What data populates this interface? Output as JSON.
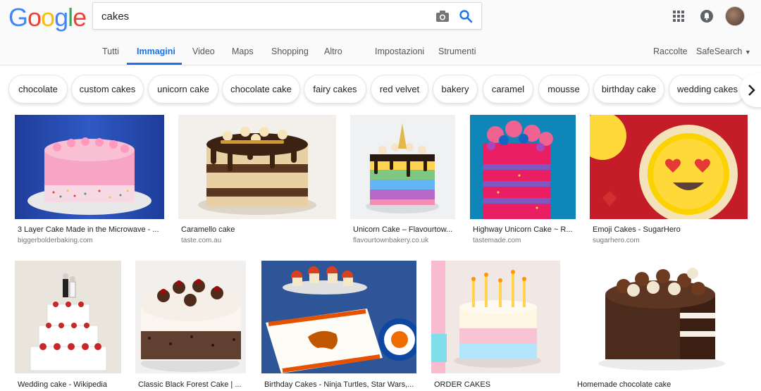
{
  "logo": {
    "letters": [
      "G",
      "o",
      "o",
      "g",
      "l",
      "e"
    ],
    "colors": [
      "#4285f4",
      "#ea4335",
      "#fbbc05",
      "#4285f4",
      "#34a853",
      "#ea4335"
    ]
  },
  "search": {
    "value": "cakes"
  },
  "nav": {
    "tabs": [
      "Tutti",
      "Immagini",
      "Video",
      "Maps",
      "Shopping",
      "Altro"
    ],
    "settings": "Impostazioni",
    "tools": "Strumenti",
    "collections": "Raccolte",
    "safesearch": "SafeSearch",
    "active_tab": "Immagini"
  },
  "chips": [
    "chocolate",
    "custom cakes",
    "unicorn cake",
    "chocolate cake",
    "fairy cakes",
    "red velvet",
    "bakery",
    "caramel",
    "mousse",
    "birthday cake",
    "wedding cakes"
  ],
  "results": [
    {
      "title": "3 Layer Cake Made in the Microwave - ...",
      "source": "biggerbolderbaking.com"
    },
    {
      "title": "Caramello cake",
      "source": "taste.com.au"
    },
    {
      "title": "Unicorn Cake – Flavourtow...",
      "source": "flavourtownbakery.co.uk"
    },
    {
      "title": "Highway Unicorn Cake ~ R...",
      "source": "tastemade.com"
    },
    {
      "title": "Emoji Cakes - SugarHero",
      "source": "sugarhero.com"
    },
    {
      "title": "Wedding cake - Wikipedia",
      "source": ""
    },
    {
      "title": "Classic Black Forest Cake | ...",
      "source": ""
    },
    {
      "title": "Birthday Cakes - Ninja Turtles, Star Wars,...",
      "source": ""
    },
    {
      "title": "ORDER CAKES",
      "source": ""
    },
    {
      "title": "Homemade chocolate cake",
      "source": ""
    }
  ],
  "colors": {
    "accent": "#1a73e8",
    "chip_border": "#e6e6e6"
  }
}
